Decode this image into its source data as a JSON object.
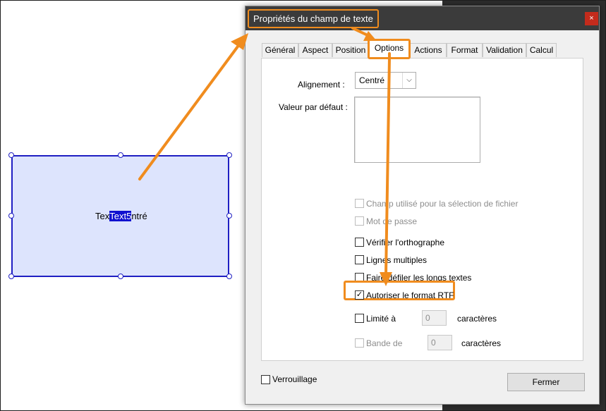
{
  "canvas": {
    "field_text_before": "Tex",
    "field_text_selected": "Text5",
    "field_text_after": "ntré"
  },
  "dialog": {
    "title": "Propriétés du champ de texte",
    "close_label": "×",
    "tabs": [
      "Général",
      "Aspect",
      "Position",
      "Options",
      "Actions",
      "Format",
      "Validation",
      "Calcul"
    ],
    "active_tab": "Options",
    "alignment_label": "Alignement :",
    "alignment_value": "Centré",
    "default_value_label": "Valeur par défaut :",
    "checkboxes": {
      "file_select": {
        "label": "Champ utilisé pour la sélection de fichier",
        "checked": false,
        "enabled": false
      },
      "password": {
        "label": "Mot de passe",
        "checked": false,
        "enabled": false
      },
      "spellcheck": {
        "label": "Vérifier l'orthographe",
        "checked": false,
        "enabled": true
      },
      "multiline": {
        "label": "Lignes multiples",
        "checked": false,
        "enabled": true
      },
      "scroll": {
        "label": "Faire défiler les longs textes",
        "checked": false,
        "enabled": true
      },
      "rtf": {
        "label": "Autoriser le format RTF",
        "checked": true,
        "enabled": true
      },
      "limit": {
        "label": "Limité à",
        "checked": false,
        "enabled": true
      },
      "comb": {
        "label": "Bande de",
        "checked": false,
        "enabled": false
      }
    },
    "limit_value": "0",
    "comb_value": "0",
    "chars_label_1": "caractères",
    "chars_label_2": "caractères",
    "lock_label": "Verrouillage",
    "close_button_label": "Fermer",
    "check_mark": "✓"
  },
  "colors": {
    "highlight": "#f08c1e",
    "field_fill": "#dde4fd",
    "field_border": "#1f1fc3",
    "titlebar": "#3b3b3b"
  }
}
